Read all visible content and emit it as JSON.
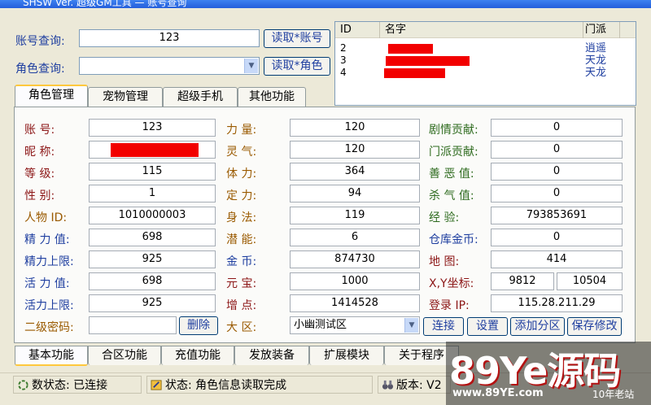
{
  "window": {
    "title": "SHSW Ver. 超级GM工具 — 账号查询"
  },
  "query": {
    "account_label": "账号查询:",
    "account_value": "123",
    "read_account_btn": "读取*账号",
    "role_label": "角色查询:",
    "role_value": "",
    "read_role_btn": "读取*角色"
  },
  "list": {
    "headers": {
      "id": "ID",
      "name": "名字",
      "sect": "门派"
    },
    "rows": [
      {
        "id": "2",
        "name": "",
        "sect": "逍遥"
      },
      {
        "id": "3",
        "name": "",
        "sect": "天龙"
      },
      {
        "id": "4",
        "name": "",
        "sect": "天龙"
      }
    ]
  },
  "tabs_top": [
    "角色管理",
    "宠物管理",
    "超级手机",
    "其他功能"
  ],
  "tabs_bottom": [
    "基本功能",
    "合区功能",
    "充值功能",
    "发放装备",
    "扩展模块",
    "关于程序"
  ],
  "form": {
    "col1": [
      {
        "label": "账    号:",
        "value": "123"
      },
      {
        "label": "昵    称:",
        "value": ""
      },
      {
        "label": "等    级:",
        "value": "115"
      },
      {
        "label": "性    别:",
        "value": "1"
      },
      {
        "label": "人物  ID:",
        "value": "1010000003"
      },
      {
        "label": "精 力 值:",
        "value": "698"
      },
      {
        "label": "精力上限:",
        "value": "925"
      },
      {
        "label": "活 力 值:",
        "value": "698"
      },
      {
        "label": "活力上限:",
        "value": "925"
      },
      {
        "label": "二级密码:",
        "value": ""
      }
    ],
    "delete_btn": "删除",
    "col2": [
      {
        "label": "力    量:",
        "value": "120"
      },
      {
        "label": "灵    气:",
        "value": "120"
      },
      {
        "label": "体    力:",
        "value": "364"
      },
      {
        "label": "定    力:",
        "value": "94"
      },
      {
        "label": "身    法:",
        "value": "119"
      },
      {
        "label": "潜    能:",
        "value": "6"
      },
      {
        "label": "金    币:",
        "value": "874730"
      },
      {
        "label": "元    宝:",
        "value": "1000"
      },
      {
        "label": "增    点:",
        "value": "1414528"
      },
      {
        "label": "大    区:",
        "value": "小幽测试区"
      }
    ],
    "col3": [
      {
        "label": "剧情贡献:",
        "value": "0"
      },
      {
        "label": "门派贡献:",
        "value": "0"
      },
      {
        "label": "善 恶 值:",
        "value": "0"
      },
      {
        "label": "杀 气 值:",
        "value": "0"
      },
      {
        "label": "经    验:",
        "value": "793853691"
      },
      {
        "label": "仓库金币:",
        "value": "0"
      },
      {
        "label": "地    图:",
        "value": "414"
      },
      {
        "label": "X,Y坐标:",
        "value": "9812",
        "value2": "10504"
      },
      {
        "label": "登录  IP:",
        "value": "115.28.211.29"
      }
    ],
    "buttons": [
      "连接",
      "设置",
      "添加分区",
      "保存修改"
    ]
  },
  "status": {
    "db": "数状态: 已连接",
    "state": "状态: 角色信息读取完成",
    "version": "版本: V2"
  },
  "watermark": {
    "brand": "89Ye源码",
    "url": "www.89YE.com",
    "tag": "10年老站"
  },
  "colors": {
    "label_red": "#8C1616",
    "label_blue": "#1F3FA0",
    "label_orange": "#9A5A00",
    "label_green": "#2E6B1E",
    "tab_highlight": "#FFC83C"
  }
}
